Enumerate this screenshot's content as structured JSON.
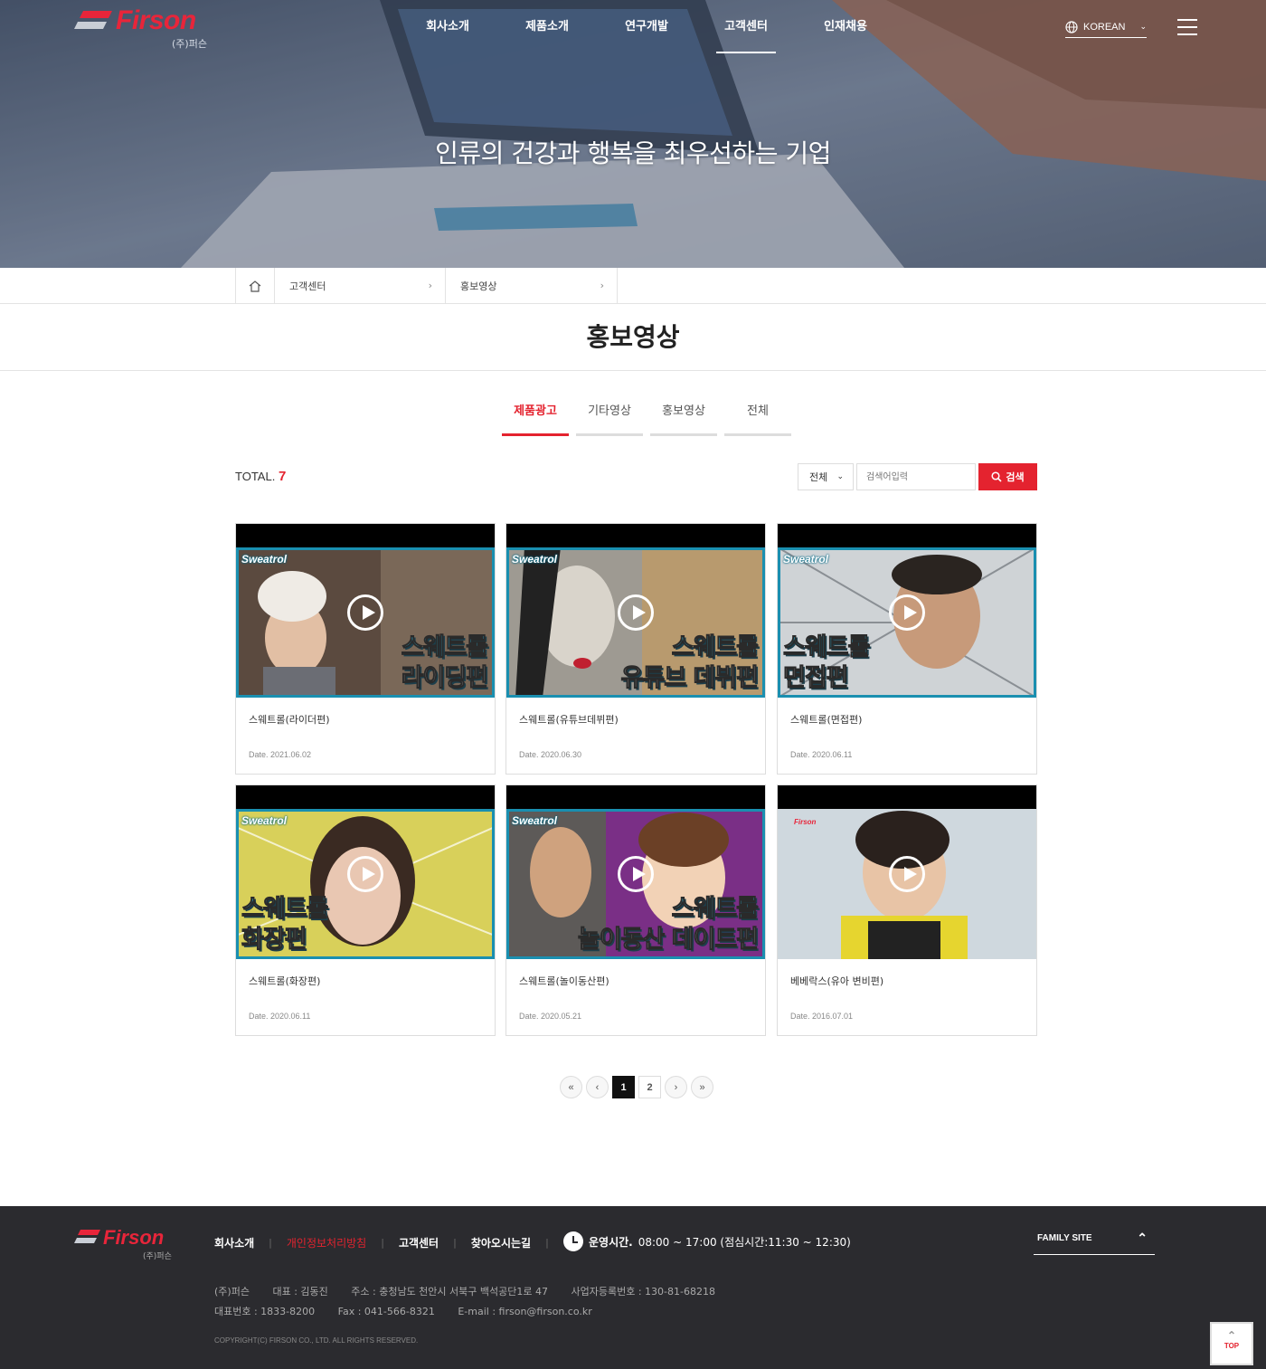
{
  "header": {
    "logo_text": "Firson",
    "logo_sub": "(주)퍼슨",
    "nav": [
      "회사소개",
      "제품소개",
      "연구개발",
      "고객센터",
      "인재채용"
    ],
    "nav_active_index": 3,
    "lang": "KOREAN"
  },
  "hero": {
    "slogan": "인류의 건강과 행복을 최우선하는 기업"
  },
  "breadcrumb": {
    "items": [
      "고객센터",
      "홍보영상"
    ]
  },
  "page": {
    "title": "홍보영상"
  },
  "tabs": [
    {
      "label": "제품광고",
      "active": true
    },
    {
      "label": "기타영상",
      "active": false
    },
    {
      "label": "홍보영상",
      "active": false
    },
    {
      "label": "전체",
      "active": false
    }
  ],
  "listing": {
    "total_label": "TOTAL.",
    "total_count": "7",
    "filter_value": "전체",
    "search_placeholder": "검색어입력",
    "search_button": "검색"
  },
  "videos": [
    {
      "title": "스웨트롤(라이더편)",
      "date": "Date. 2021.06.02",
      "brand": "Sweatrol",
      "line1": "스웨트롤",
      "line2": "라이딩편"
    },
    {
      "title": "스웨트롤(유튜브데뷔편)",
      "date": "Date. 2020.06.30",
      "brand": "Sweatrol",
      "line1": "스웨트롤",
      "line2": "유튜브 데뷔편"
    },
    {
      "title": "스웨트롤(면접편)",
      "date": "Date. 2020.06.11",
      "brand": "Sweatrol",
      "line1": "스웨트롤",
      "line2": "면접편"
    },
    {
      "title": "스웨트롤(화장편)",
      "date": "Date. 2020.06.11",
      "brand": "Sweatrol",
      "line1": "스웨트롤",
      "line2": "화장편"
    },
    {
      "title": "스웨트롤(놀이동산편)",
      "date": "Date. 2020.05.21",
      "brand": "Sweatrol",
      "line1": "스웨트롤",
      "line2": "놀이동산 데이트편"
    },
    {
      "title": "베베락스(유아 변비편)",
      "date": "Date. 2016.07.01",
      "brand": "Firson",
      "line1": "",
      "line2": ""
    }
  ],
  "pagination": {
    "first": "«",
    "prev": "‹",
    "pages": [
      "1",
      "2"
    ],
    "current": "1",
    "next": "›",
    "last": "»"
  },
  "footer": {
    "logo_text": "Firson",
    "logo_sub": "(주)퍼슨",
    "links": [
      "회사소개",
      "개인정보처리방침",
      "고객센터",
      "찾아오시는길"
    ],
    "hours_label": "운영시간.",
    "hours_value": "08:00 ~ 17:00 (점심시간:11:30 ~ 12:30)",
    "family_site": "FAMILY SITE",
    "company": "(주)퍼슨",
    "ceo": "대표 : 김동진",
    "address": "주소 : 충청남도 천안시 서북구 백석공단1로 47",
    "bizno": "사업자등록번호 : 130-81-68218",
    "tel": "대표번호 : 1833-8200",
    "fax": "Fax : 041-566-8321",
    "email": "E-mail : firson@firson.co.kr",
    "copyright": "COPYRIGHT(C) FIRSON CO., LTD. ALL RIGHTS RESERVED.",
    "top_label": "TOP"
  },
  "colors": {
    "accent": "#e4232f",
    "footer_bg": "#2b2b2f",
    "thumb_frame": "#1a8fb0"
  }
}
